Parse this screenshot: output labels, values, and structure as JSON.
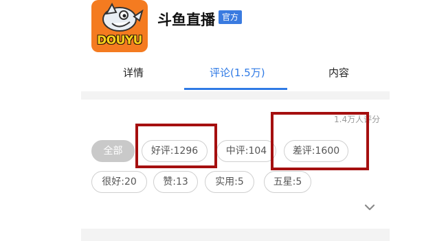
{
  "app": {
    "logo_text": "DOUYU",
    "title": "斗鱼直播",
    "badge": "官方"
  },
  "tabs": [
    {
      "label": "详情",
      "active": false
    },
    {
      "label": "评论(1.5万)",
      "active": true
    },
    {
      "label": "内容",
      "active": false
    }
  ],
  "reviews": {
    "rating_count": "1.4万人评分",
    "filters": [
      {
        "label": "全部",
        "active": true
      },
      {
        "label": "好评:1296",
        "active": false,
        "highlighted": true
      },
      {
        "label": "中评:104",
        "active": false
      },
      {
        "label": "差评:1600",
        "active": false,
        "highlighted": true
      },
      {
        "label": "很好:20",
        "active": false
      },
      {
        "label": "赞:13",
        "active": false
      },
      {
        "label": "实用:5",
        "active": false
      },
      {
        "label": "五星:5",
        "active": false
      }
    ],
    "expand_icon": "chevron-down-icon"
  },
  "colors": {
    "accent": "#2f7ae5",
    "badge": "#3a7be0",
    "logo_bg": "#f47b20",
    "highlight_box": "#a50f0f",
    "chip_active_bg": "#c9c9c9"
  }
}
